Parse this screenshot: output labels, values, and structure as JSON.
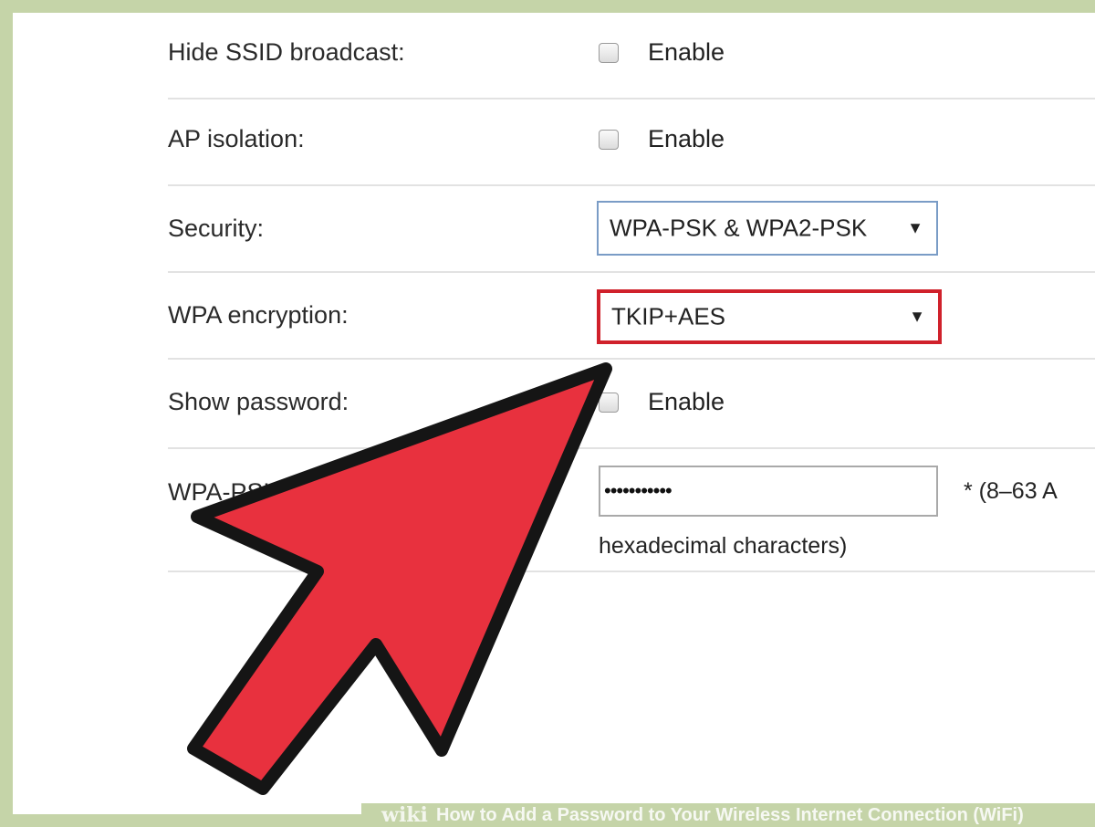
{
  "settings": {
    "hide_ssid": {
      "label": "Hide SSID broadcast:",
      "option": "Enable",
      "checked": false
    },
    "ap_isolation": {
      "label": "AP isolation:",
      "option": "Enable",
      "checked": false
    },
    "security": {
      "label": "Security:",
      "value": "WPA-PSK & WPA2-PSK"
    },
    "wpa_encryption": {
      "label": "WPA encryption:",
      "value": "TKIP+AES",
      "highlight_color": "#d0212b"
    },
    "show_password": {
      "label": "Show password:",
      "option": "Enable",
      "checked": false
    },
    "wpa_psk": {
      "label": "WPA-PSK",
      "value_masked": "•••••••••••",
      "hint_line1": "*   (8–63 A",
      "hint_line2": "hexadecimal characters)"
    }
  },
  "overlay": {
    "arrow_color": "#e8313e",
    "arrow_icon": "pointer-arrow-icon"
  },
  "watermark": {
    "brand": "wiki",
    "title": "How to Add a Password to Your Wireless Internet Connection (WiFi)"
  }
}
